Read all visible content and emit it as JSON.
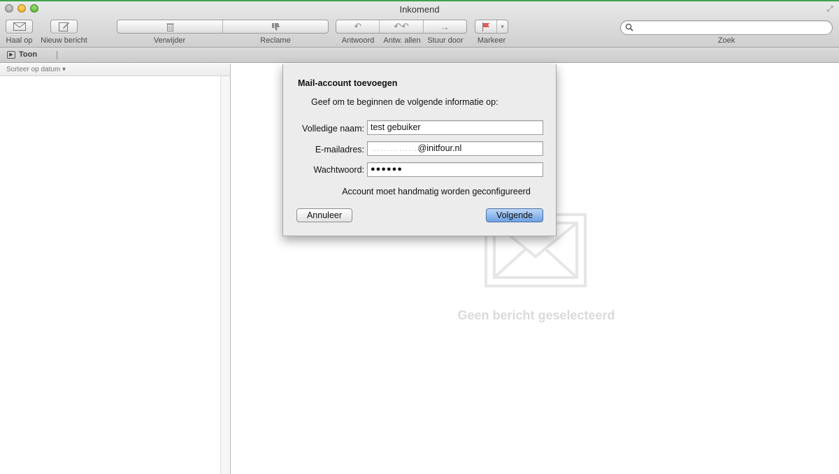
{
  "window": {
    "title": "Inkomend"
  },
  "toolbar": {
    "get_mail": "Haal op",
    "new_message": "Nieuw bericht",
    "delete": "Verwijder",
    "junk": "Reclame",
    "reply": "Antwoord",
    "reply_all": "Antw. allen",
    "forward": "Stuur door",
    "flag": "Markeer",
    "search_label": "Zoek",
    "search_placeholder": ""
  },
  "favorites": {
    "show": "Toon"
  },
  "list": {
    "sort_label": "Sorteer op datum ▾"
  },
  "preview": {
    "empty_text": "Geen bericht geselecteerd"
  },
  "dialog": {
    "title": "Mail-account toevoegen",
    "intro": "Geef om te beginnen de volgende informatie op:",
    "full_name_label": "Volledige naam:",
    "full_name_value": "test gebuiker",
    "email_label": "E-mailadres:",
    "email_masked": "……………",
    "email_domain": "@initfour.nl",
    "password_label": "Wachtwoord:",
    "password_value": "●●●●●●",
    "note": "Account moet handmatig worden geconfigureerd",
    "cancel_label": "Annuleer",
    "next_label": "Volgende"
  },
  "colors": {
    "accent_blue": "#6fa1e3",
    "window_green": "#3fa34d"
  }
}
